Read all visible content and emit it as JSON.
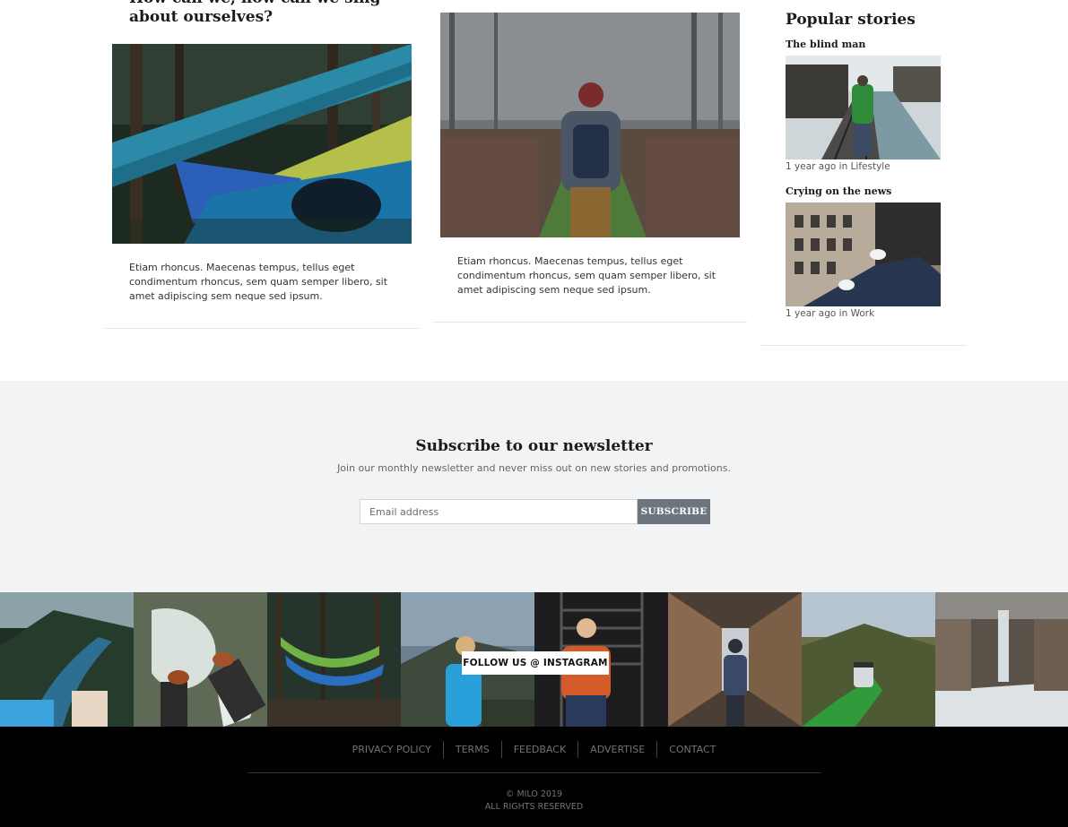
{
  "cards": [
    {
      "title": "How can we, how can we sing about ourselves?",
      "text": "Etiam rhoncus. Maecenas tempus, tellus eget condimentum rhoncus, sem quam semper libero, sit amet adipiscing sem neque sed ipsum."
    },
    {
      "text": "Etiam rhoncus. Maecenas tempus, tellus eget condimentum rhoncus, sem quam semper libero, sit amet adipiscing sem neque sed ipsum."
    }
  ],
  "popular": {
    "heading": "Popular stories",
    "stories": [
      {
        "title": "The blind man",
        "time": "1 year ago",
        "in": "in",
        "category": "Lifestyle"
      },
      {
        "title": "Crying on the news",
        "time": "1 year ago",
        "in": "in",
        "category": "Work"
      }
    ]
  },
  "newsletter": {
    "title": "Subscribe to our newsletter",
    "subtitle": "Join our monthly newsletter and never miss out on new stories and promotions.",
    "placeholder": "Email address",
    "button": "SUBSCRIBE"
  },
  "instagram": {
    "follow_label": "FOLLOW US @ INSTAGRAM"
  },
  "footer": {
    "links": [
      "PRIVACY POLICY",
      "TERMS",
      "FEEDBACK",
      "ADVERTISE",
      "CONTACT"
    ],
    "copyright": "© MILO 2019",
    "rights": "ALL RIGHTS RESERVED"
  },
  "colors": {
    "newsletter_bg": "#f2f3f4",
    "button_bg": "#6c757d",
    "footer_bg": "#000000",
    "footer_text": "#6c757d"
  }
}
